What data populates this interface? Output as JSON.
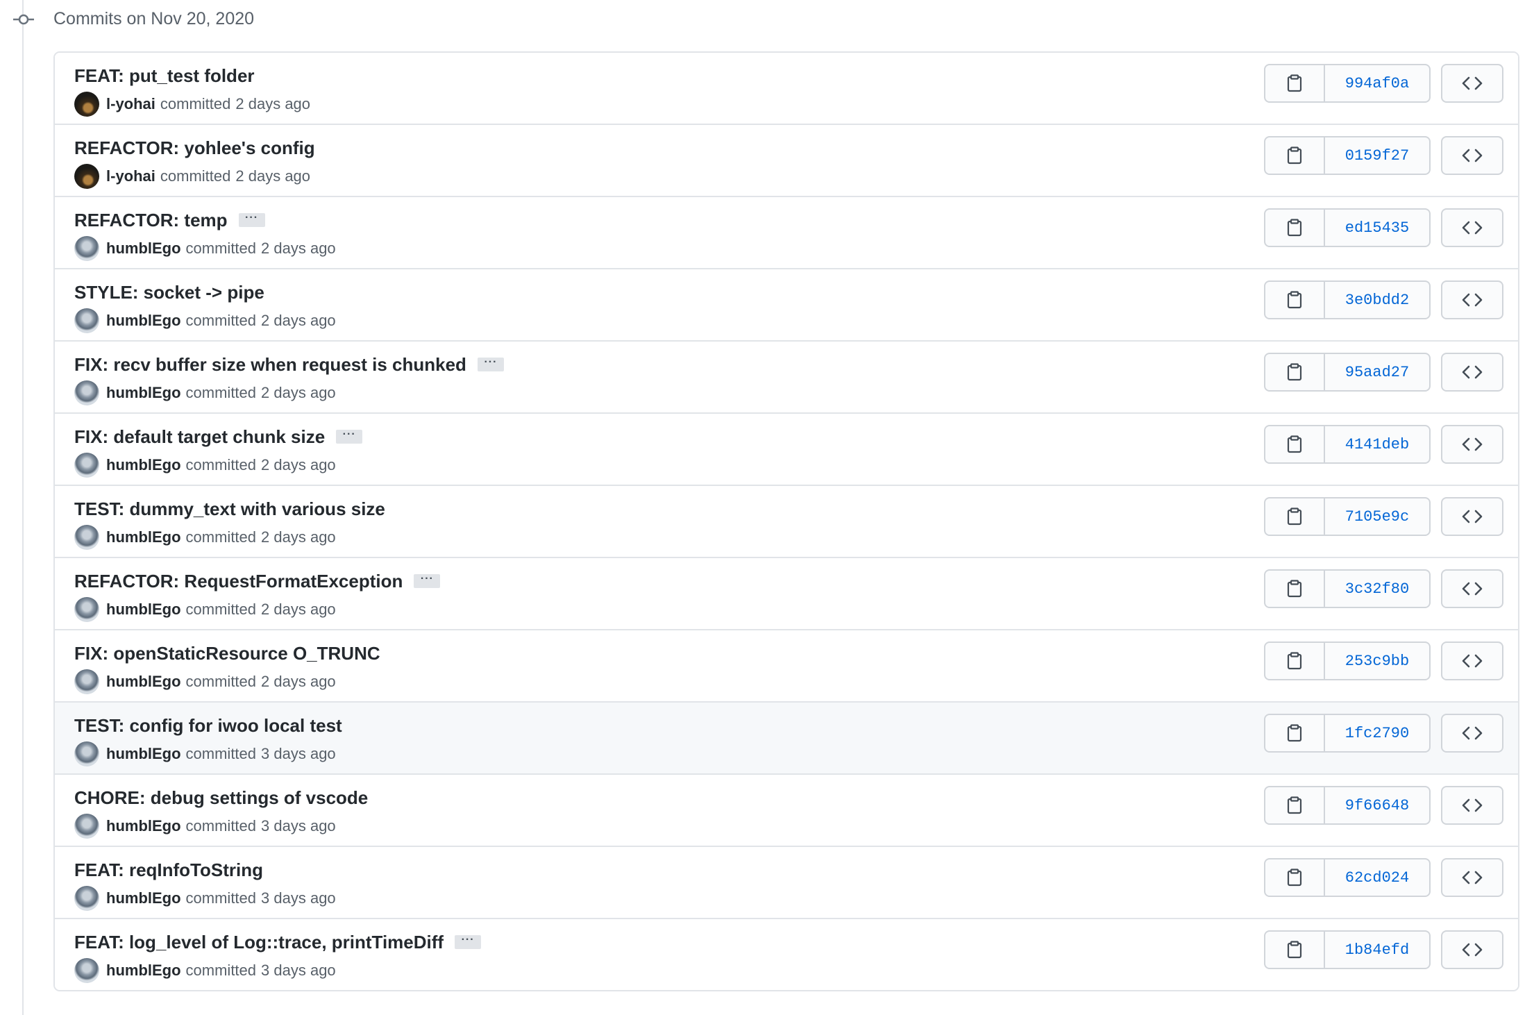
{
  "header": {
    "date_label": "Commits on Nov 20, 2020",
    "icon": "git-commit-icon"
  },
  "colors": {
    "sha_link": "#0366d6",
    "border": "#e1e4e8",
    "muted_text": "#586069",
    "highlight_row": "#f6f8fa"
  },
  "commits": [
    {
      "message": "FEAT: put_test folder",
      "has_ellipsis": false,
      "author": "l-yohai",
      "avatar": "avatar-dark",
      "verb": "committed",
      "time": "2 days ago",
      "sha": "994af0a"
    },
    {
      "message": "REFACTOR: yohlee's config",
      "has_ellipsis": false,
      "author": "l-yohai",
      "avatar": "avatar-dark",
      "verb": "committed",
      "time": "2 days ago",
      "sha": "0159f27"
    },
    {
      "message": "REFACTOR: temp",
      "has_ellipsis": true,
      "author": "humblEgo",
      "avatar": "avatar-light",
      "verb": "committed",
      "time": "2 days ago",
      "sha": "ed15435"
    },
    {
      "message": "STYLE: socket -> pipe",
      "has_ellipsis": false,
      "author": "humblEgo",
      "avatar": "avatar-light",
      "verb": "committed",
      "time": "2 days ago",
      "sha": "3e0bdd2"
    },
    {
      "message": "FIX: recv buffer size when request is chunked",
      "has_ellipsis": true,
      "author": "humblEgo",
      "avatar": "avatar-light",
      "verb": "committed",
      "time": "2 days ago",
      "sha": "95aad27"
    },
    {
      "message": "FIX: default target chunk size",
      "has_ellipsis": true,
      "author": "humblEgo",
      "avatar": "avatar-light",
      "verb": "committed",
      "time": "2 days ago",
      "sha": "4141deb"
    },
    {
      "message": "TEST: dummy_text with various size",
      "has_ellipsis": false,
      "author": "humblEgo",
      "avatar": "avatar-light",
      "verb": "committed",
      "time": "2 days ago",
      "sha": "7105e9c"
    },
    {
      "message": "REFACTOR: RequestFormatException",
      "has_ellipsis": true,
      "author": "humblEgo",
      "avatar": "avatar-light",
      "verb": "committed",
      "time": "2 days ago",
      "sha": "3c32f80"
    },
    {
      "message": "FIX: openStaticResource O_TRUNC",
      "has_ellipsis": false,
      "author": "humblEgo",
      "avatar": "avatar-light",
      "verb": "committed",
      "time": "2 days ago",
      "sha": "253c9bb"
    },
    {
      "message": "TEST: config for iwoo local test",
      "has_ellipsis": false,
      "author": "humblEgo",
      "avatar": "avatar-light",
      "verb": "committed",
      "time": "3 days ago",
      "sha": "1fc2790",
      "highlighted": true
    },
    {
      "message": "CHORE: debug settings of vscode",
      "has_ellipsis": false,
      "author": "humblEgo",
      "avatar": "avatar-light",
      "verb": "committed",
      "time": "3 days ago",
      "sha": "9f66648"
    },
    {
      "message": "FEAT: reqInfoToString",
      "has_ellipsis": false,
      "author": "humblEgo",
      "avatar": "avatar-light",
      "verb": "committed",
      "time": "3 days ago",
      "sha": "62cd024"
    },
    {
      "message": "FEAT: log_level of Log::trace, printTimeDiff",
      "has_ellipsis": true,
      "author": "humblEgo",
      "avatar": "avatar-light",
      "verb": "committed",
      "time": "3 days ago",
      "sha": "1b84efd"
    }
  ],
  "buttons": {
    "copy_icon": "clipboard-icon",
    "browse_icon": "code-icon",
    "ellipsis_text": "···"
  }
}
